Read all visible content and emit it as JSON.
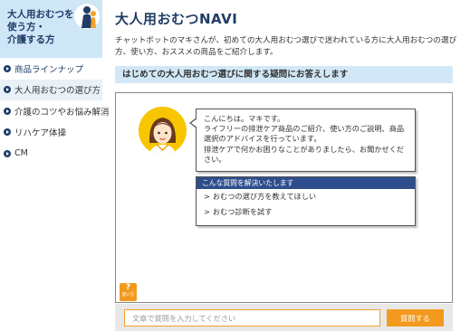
{
  "sidebar": {
    "title_lines": [
      "大人用おむつを",
      "使う方・",
      "介護する方"
    ],
    "items": [
      {
        "label": "商品ラインナップ"
      },
      {
        "label": "大人用おむつの選び方"
      },
      {
        "label": "介護のコツやお悩み解消"
      },
      {
        "label": "リハケア体操"
      },
      {
        "label": "CM"
      }
    ]
  },
  "main": {
    "title": "大人用おむつNAVI",
    "intro": "チャットボットのマキさんが、初めての大人用おむつ選びで迷われている方に大人用おむつの選び方、使い方、おススメの商品をご紹介します。",
    "section_title": "はじめての大人用おむつ選びに関する疑問にお答えします"
  },
  "chat": {
    "greeting_lines": [
      "こんにちは。マキです。",
      "ライフリーの排泄ケア商品のご紹介、使い方のご説明、商品",
      "選択のアドバイスを行っています。",
      "排泄ケアで何かお困りなことがありましたら、お聞かせくだ",
      "さい。"
    ],
    "card_title": "こんな質問を解決いたします",
    "questions": [
      "おむつの選び方を教えてほしい",
      "おむつ診断を試す"
    ],
    "help_symbol": "?",
    "help_label": "使い方"
  },
  "input": {
    "placeholder": "文章で質問を入力してください",
    "send_label": "質問する"
  },
  "colors": {
    "accent": "#f39a1e",
    "navy": "#1f3d66",
    "header_bg": "#cfe6f7",
    "card_head": "#2e4d8c"
  }
}
